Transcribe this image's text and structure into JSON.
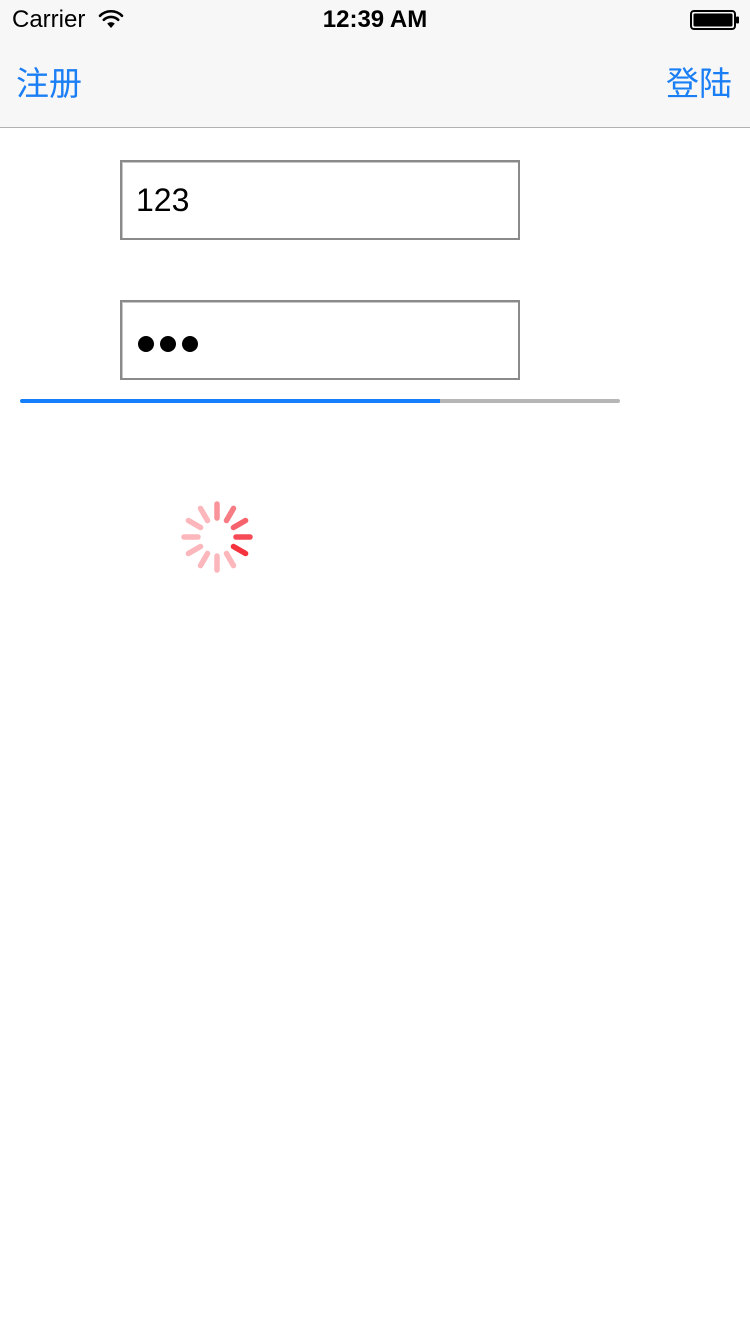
{
  "status_bar": {
    "carrier": "Carrier",
    "time": "12:39 AM",
    "icons": [
      "wifi-icon",
      "battery-icon"
    ]
  },
  "nav_bar": {
    "left_label": "注册",
    "right_label": "登陆",
    "tint_color": "#1a7ef5"
  },
  "form": {
    "username_value": "123",
    "password_value": "•••",
    "password_length": 3
  },
  "progress": {
    "value": 0.7,
    "fill_color": "#147efb",
    "track_color": "#b6b6b6"
  },
  "activity_indicator": {
    "icon": "spinner-icon",
    "color": "#f5333f",
    "animating": true
  }
}
